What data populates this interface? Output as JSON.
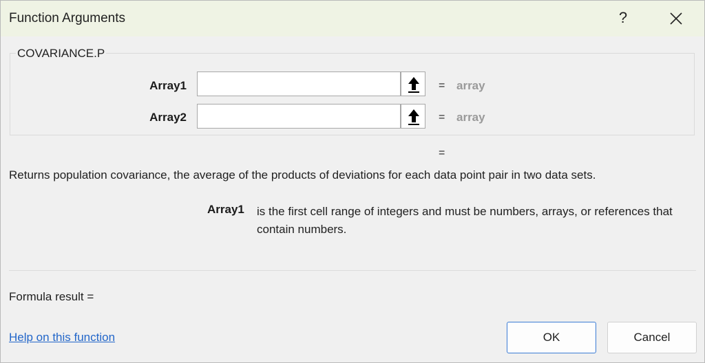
{
  "window": {
    "title": "Function Arguments",
    "help_glyph": "?",
    "help_icon": "question-mark-icon",
    "close_icon": "close-x-icon"
  },
  "function": {
    "name": "COVARIANCE.P",
    "arguments": [
      {
        "label": "Array1",
        "value": "",
        "equals": "=",
        "result": "array"
      },
      {
        "label": "Array2",
        "value": "",
        "equals": "=",
        "result": "array"
      }
    ],
    "overall_equals": "=",
    "description": "Returns population covariance, the average of the products of deviations for each data point pair in two data sets.",
    "param_help": {
      "name": "Array1",
      "text": "is the first cell range of integers and must be numbers, arrays, or references that contain numbers."
    }
  },
  "footer": {
    "formula_result": "Formula result =",
    "help_link": "Help on this function",
    "ok_label": "OK",
    "cancel_label": "Cancel"
  },
  "colors": {
    "titlebar": "#eff3e4",
    "dialog_bg": "#f0f0f0",
    "link": "#2266c9",
    "ok_border": "#3a7bd5",
    "muted_value": "#9a9a9a"
  }
}
